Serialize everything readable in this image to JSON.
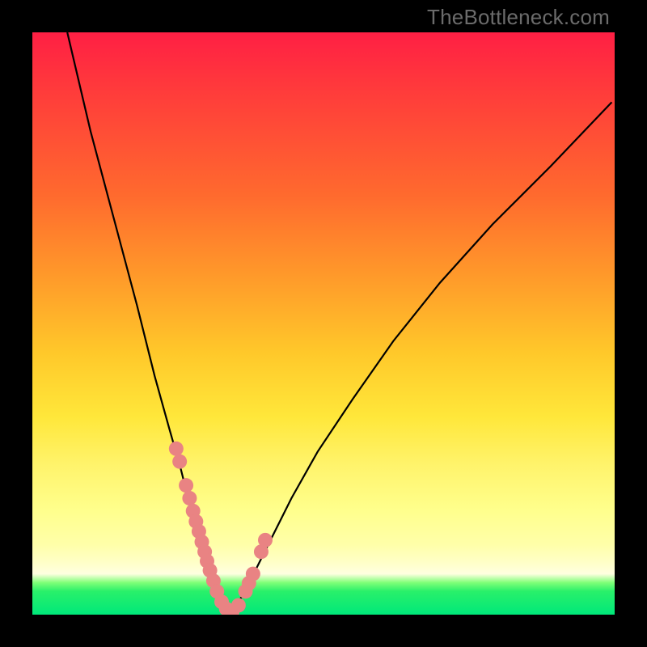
{
  "watermark": "TheBottleneck.com",
  "colors": {
    "dot": "#e98383",
    "curve": "#000000",
    "frame": "#000000"
  },
  "chart_data": {
    "type": "line",
    "title": "",
    "xlabel": "",
    "ylabel": "",
    "xlim": [
      0,
      100
    ],
    "ylim": [
      0,
      100
    ],
    "note": "Axes are unlabeled; values below are read off the plot geometry (percent of plot width/height).",
    "series": [
      {
        "name": "curve-left",
        "x": [
          6,
          10,
          14,
          18,
          21,
          23.5,
          25.5,
          27,
          28.3,
          29.4,
          30.4,
          31.2,
          31.9,
          32.5,
          33.1,
          33.6,
          34.0
        ],
        "y": [
          100,
          83,
          68,
          53,
          41,
          32,
          25,
          19,
          14,
          10,
          7,
          5,
          3.5,
          2.3,
          1.4,
          0.7,
          0.15
        ]
      },
      {
        "name": "curve-right",
        "x": [
          34.0,
          35.0,
          36.5,
          38.5,
          41,
          44.5,
          49,
          55,
          62,
          70,
          79,
          89,
          99.5
        ],
        "y": [
          0.15,
          1.5,
          4,
          8,
          13,
          20,
          28,
          37,
          47,
          57,
          67,
          77,
          88
        ]
      }
    ],
    "points": {
      "name": "highlight-dots",
      "note": "Pink markers clustered near the trough of the curve.",
      "x": [
        24.7,
        25.3,
        26.4,
        27.0,
        27.6,
        28.1,
        28.6,
        29.1,
        29.6,
        30.0,
        30.5,
        31.1,
        31.7,
        32.5,
        33.3,
        34.3,
        35.4,
        36.6,
        37.2,
        37.9,
        39.3,
        40.0
      ],
      "y": [
        28.5,
        26.3,
        22.2,
        20.0,
        17.8,
        16.0,
        14.3,
        12.5,
        10.8,
        9.2,
        7.6,
        5.8,
        4.0,
        2.2,
        1.0,
        0.4,
        1.6,
        4.0,
        5.4,
        7.0,
        10.8,
        12.8
      ]
    }
  }
}
